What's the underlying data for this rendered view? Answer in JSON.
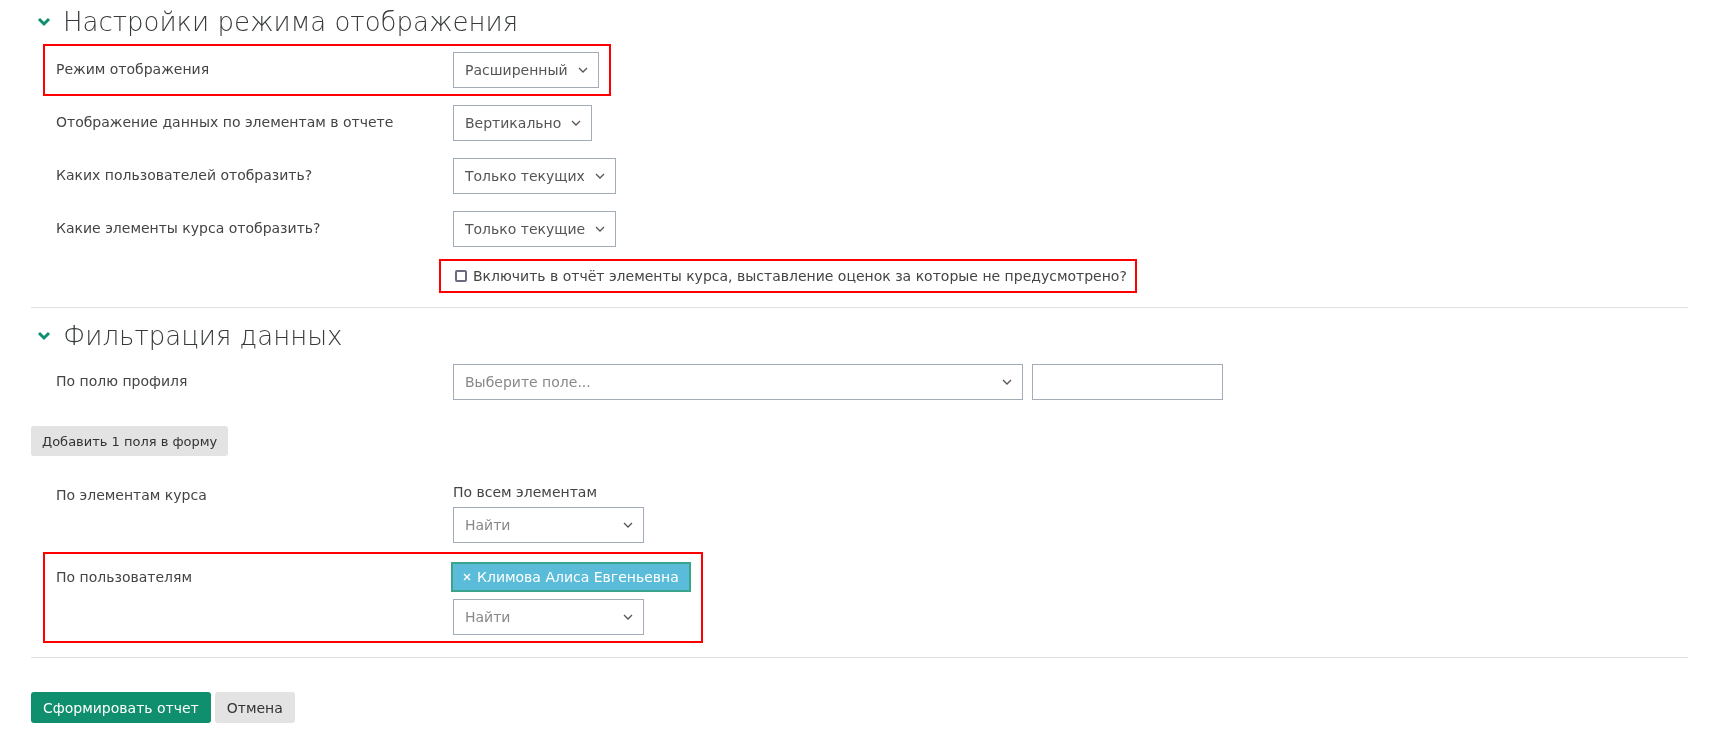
{
  "sections": [
    {
      "title": "Настройки режима отображения",
      "expanded": true,
      "rows": [
        {
          "kind": "select",
          "label": "Режим отображения",
          "value": "Расширенный",
          "highlighted": true
        },
        {
          "kind": "select",
          "label": "Отображение данных по элементам в отчете",
          "value": "Вертикально",
          "highlighted": false
        },
        {
          "kind": "select",
          "label": "Каких пользователей отобразить?",
          "value": "Только текущих",
          "highlighted": false
        },
        {
          "kind": "select",
          "label": "Какие элементы курса отобразить?",
          "value": "Только текущие",
          "highlighted": false
        },
        {
          "kind": "checkbox",
          "label": "Включить в отчёт элементы курса, выставление оценок за которые не предусмотрено?",
          "checked": false,
          "highlighted": true
        }
      ]
    },
    {
      "title": "Фильтрация данных",
      "expanded": true,
      "rows": [
        {
          "kind": "profile",
          "label": "По полю профиля",
          "placeholder": "Выберите поле...",
          "highlighted": false
        },
        {
          "kind": "button",
          "label": "Добавить 1 поля в форму"
        },
        {
          "kind": "autocomplete",
          "label": "По элементам курса",
          "caption": "По всем элементам",
          "placeholder": "Найти",
          "highlighted": false
        },
        {
          "kind": "autocomplete",
          "label": "По пользователям",
          "tags": [
            "Климова Алиса Евгеньевна"
          ],
          "placeholder": "Найти",
          "highlighted": true
        }
      ]
    }
  ],
  "buttons": [
    {
      "label": "Сформировать отчет",
      "primary": true
    },
    {
      "label": "Отмена",
      "primary": false
    }
  ]
}
